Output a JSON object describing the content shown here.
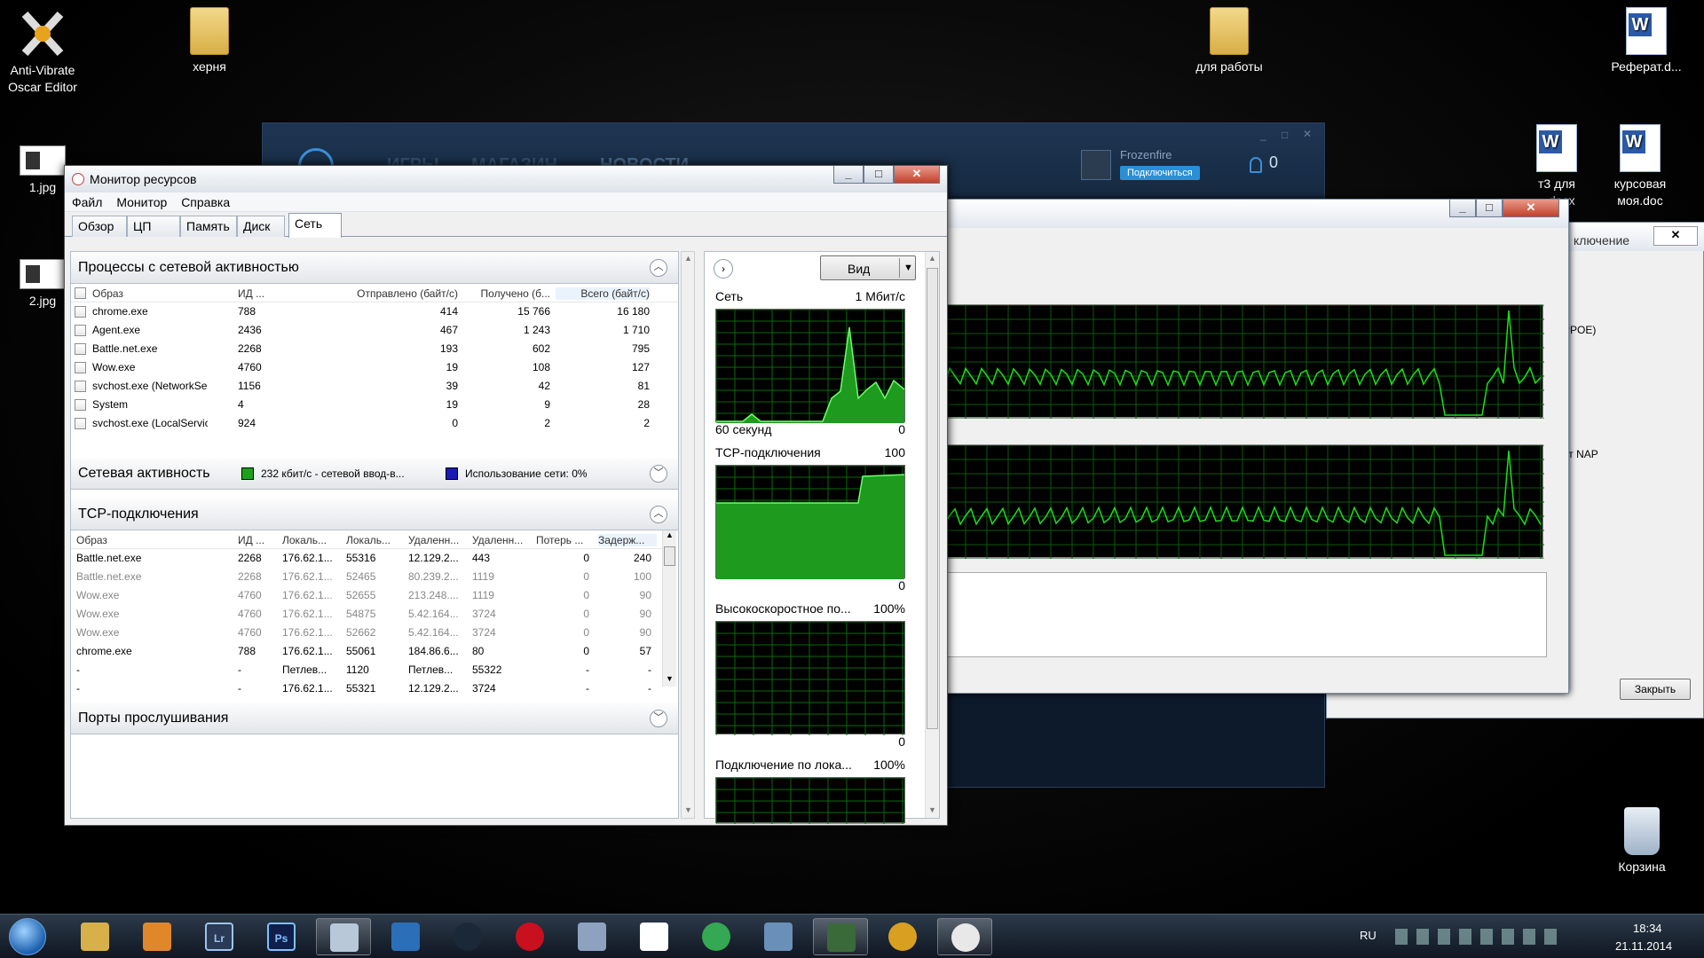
{
  "desktop": {
    "icons": [
      {
        "label": "Anti-Vibrate\nOscar Editor",
        "icon": "app-x-icon"
      },
      {
        "label": "херня",
        "icon": "folder-icon"
      },
      {
        "label": "1.jpg",
        "icon": "image-icon"
      },
      {
        "label": "2.jpg",
        "icon": "image-icon"
      },
      {
        "label": "для работы",
        "icon": "folder-icon"
      },
      {
        "label": "Реферат.d...",
        "icon": "word-doc-icon"
      },
      {
        "label": "т3 для\n...docx",
        "icon": "word-doc-icon"
      },
      {
        "label": "курсовая\nмоя.doc",
        "icon": "word-doc-icon"
      },
      {
        "label": "Корзина",
        "icon": "recycle-bin-icon"
      }
    ]
  },
  "battlenet": {
    "nav": [
      "ИГРЫ",
      "МАГАЗИН",
      "НОВОСТИ"
    ],
    "user": "Frozenfire",
    "connect_label": "Подключиться",
    "friends_count": "0"
  },
  "netwin": {
    "title_partial": "ключение",
    "label_pppoe": "PPOE)",
    "label_nap": "ет NAP",
    "close_label": "Закрыть"
  },
  "resmon": {
    "title": "Монитор ресурсов",
    "menu": [
      "Файл",
      "Монитор",
      "Справка"
    ],
    "tabs": [
      "Обзор",
      "ЦП",
      "Память",
      "Диск",
      "Сеть"
    ],
    "active_tab": "Сеть",
    "processes": {
      "title": "Процессы с сетевой активностью",
      "columns": [
        "Образ",
        "ИД ...",
        "Отправлено (байт/с)",
        "Получено (б...",
        "Всего (байт/с)"
      ],
      "rows": [
        [
          "chrome.exe",
          "788",
          "414",
          "15 766",
          "16 180"
        ],
        [
          "Agent.exe",
          "2436",
          "467",
          "1 243",
          "1 710"
        ],
        [
          "Battle.net.exe",
          "2268",
          "193",
          "602",
          "795"
        ],
        [
          "Wow.exe",
          "4760",
          "19",
          "108",
          "127"
        ],
        [
          "svchost.exe (NetworkSer...",
          "1156",
          "39",
          "42",
          "81"
        ],
        [
          "System",
          "4",
          "19",
          "9",
          "28"
        ],
        [
          "svchost.exe (LocalServic...",
          "924",
          "0",
          "2",
          "2"
        ]
      ]
    },
    "network_activity": {
      "title": "Сетевая активность",
      "io_text": "232 кбит/с - сетевой ввод-в...",
      "io_color": "#1aa31a",
      "usage_text": "Использование сети: 0%",
      "usage_color": "#1a1ab8"
    },
    "tcp": {
      "title": "TCP-подключения",
      "columns": [
        "Образ",
        "ИД ...",
        "Локаль...",
        "Локаль...",
        "Удаленн...",
        "Удаленн...",
        "Потерь ...",
        "Задерж..."
      ],
      "rows": [
        [
          "Battle.net.exe",
          "2268",
          "176.62.1...",
          "55316",
          "12.129.2...",
          "443",
          "0",
          "240"
        ],
        [
          "Battle.net.exe",
          "2268",
          "176.62.1...",
          "52465",
          "80.239.2...",
          "1119",
          "0",
          "100"
        ],
        [
          "Wow.exe",
          "4760",
          "176.62.1...",
          "52655",
          "213.248....",
          "1119",
          "0",
          "90"
        ],
        [
          "Wow.exe",
          "4760",
          "176.62.1...",
          "54875",
          "5.42.164...",
          "3724",
          "0",
          "90"
        ],
        [
          "Wow.exe",
          "4760",
          "176.62.1...",
          "52662",
          "5.42.164...",
          "3724",
          "0",
          "90"
        ],
        [
          "chrome.exe",
          "788",
          "176.62.1...",
          "55061",
          "184.86.6...",
          "80",
          "0",
          "57"
        ],
        [
          "-",
          "-",
          "Петлев...",
          "1120",
          "Петлев...",
          "55322",
          "-",
          "-"
        ],
        [
          "-",
          "-",
          "176.62.1...",
          "55321",
          "12.129.2...",
          "3724",
          "-",
          "-"
        ]
      ],
      "gray_rows": [
        1,
        2,
        3,
        4
      ]
    },
    "ports": {
      "title": "Порты прослушивания"
    },
    "view_button": "Вид",
    "graphs": [
      {
        "label": "Сеть",
        "max": "1 Мбит/с",
        "bottom_left": "60 секунд",
        "bottom_right": "0"
      },
      {
        "label": "TCP-подключения",
        "max": "100",
        "bottom_left": "",
        "bottom_right": "0"
      },
      {
        "label": "Высокоскоростное по...",
        "max": "100%",
        "bottom_left": "",
        "bottom_right": "0"
      },
      {
        "label": "Подключение по лока...",
        "max": "100%",
        "bottom_left": "",
        "bottom_right": ""
      }
    ]
  },
  "taskbar": {
    "apps": [
      "start-orb-icon",
      "explorer-icon",
      "media-player-icon",
      "lightroom-icon",
      "photoshop-icon",
      "notes-icon",
      "battlenet-icon",
      "steam-icon",
      "opera-icon",
      "calculator-icon",
      "yandex-icon",
      "chrome-icon",
      "control-panel-icon",
      "resource-monitor-taskbar-icon",
      "wow-icon",
      "resmon-icon"
    ],
    "lr_label": "Lr",
    "ps_label": "Ps",
    "lang": "RU",
    "time": "18:34",
    "date": "21.11.2014"
  }
}
